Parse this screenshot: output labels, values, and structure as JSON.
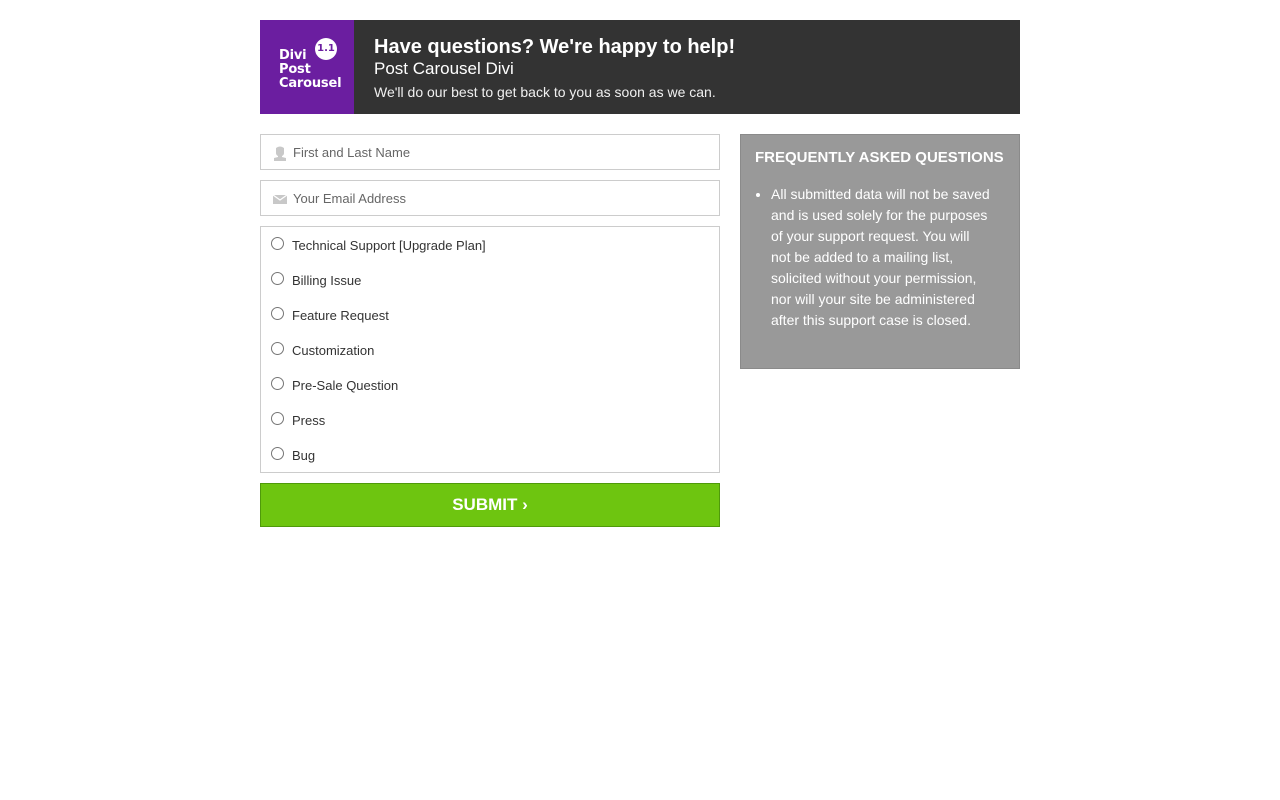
{
  "header": {
    "logo": {
      "line1": "Divi",
      "line2": "Post",
      "line3": "Carousel",
      "version": "1.1",
      "color": "#6b1ea0"
    },
    "title": "Have questions? We're happy to help!",
    "product": "Post Carousel Divi",
    "subtitle": "We'll do our best to get back to you as soon as we can."
  },
  "form": {
    "name_placeholder": "First and Last Name",
    "email_placeholder": "Your Email Address",
    "topics": [
      "Technical Support [Upgrade Plan]",
      "Billing Issue",
      "Feature Request",
      "Customization",
      "Pre-Sale Question",
      "Press",
      "Bug"
    ],
    "submit_label": "SUBMIT ›",
    "submit_color": "#6ec510"
  },
  "faq": {
    "title": "FREQUENTLY ASKED QUESTIONS",
    "items": [
      "All submitted data will not be saved and is used solely for the purposes of your support request. You will not be added to a mailing list, solicited without your permission, nor will your site be administered after this support case is closed."
    ]
  },
  "icons": {
    "name_field": "user-icon",
    "email_field": "envelope-icon"
  }
}
